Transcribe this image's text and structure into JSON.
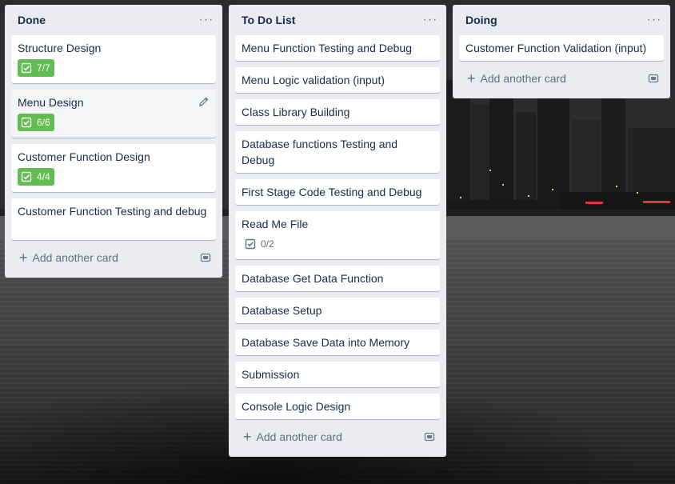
{
  "board": {
    "lists": [
      {
        "title": "Done",
        "cards": [
          {
            "title": "Structure Design",
            "badge": "7/7"
          },
          {
            "title": "Menu Design",
            "badge": "6/6"
          },
          {
            "title": "Customer Function Design",
            "badge": "4/4"
          },
          {
            "title": "Customer Function Testing and debug"
          }
        ],
        "add_label": "Add another card"
      },
      {
        "title": "To Do List",
        "cards": [
          {
            "title": "Menu Function Testing and Debug"
          },
          {
            "title": "Menu Logic validation (input)"
          },
          {
            "title": "Class Library Building"
          },
          {
            "title": "Database functions Testing and Debug"
          },
          {
            "title": "First Stage Code Testing and Debug"
          },
          {
            "title": "Read Me File",
            "badge": "0/2"
          },
          {
            "title": "Database Get Data Function"
          },
          {
            "title": "Database Setup"
          },
          {
            "title": "Database Save Data into Memory"
          },
          {
            "title": "Submission"
          },
          {
            "title": "Console Logic Design"
          }
        ],
        "add_label": "Add another card"
      },
      {
        "title": "Doing",
        "cards": [
          {
            "title": "Customer Function Validation (input)"
          }
        ],
        "add_label": "Add another card"
      }
    ]
  },
  "menu_glyph": "···",
  "colors": {
    "list_bg": "#ebecf0",
    "card_bg": "#ffffff",
    "badge_complete": "#61bd4f",
    "text": "#172b4d"
  }
}
